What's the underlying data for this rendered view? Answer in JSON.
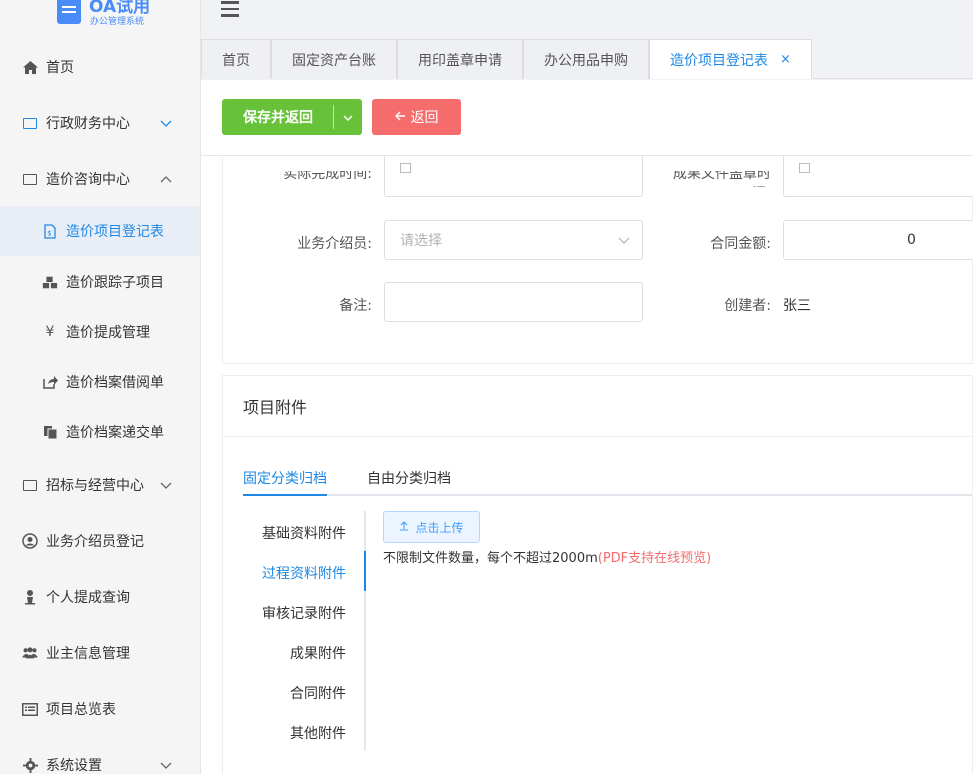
{
  "app": {
    "title": "OA试用",
    "subtitle": "办公管理系统"
  },
  "sidebar": {
    "items": [
      {
        "label": "首页",
        "icon": "home-icon"
      },
      {
        "label": "行政财务中心",
        "icon": "folder-icon"
      },
      {
        "label": "造价咨询中心",
        "icon": "folder-icon"
      },
      {
        "label": "造价项目登记表",
        "icon": "file-icon"
      },
      {
        "label": "造价跟踪子项目",
        "icon": "cubes-icon"
      },
      {
        "label": "造价提成管理",
        "icon": "yen-icon"
      },
      {
        "label": "造价档案借阅单",
        "icon": "share-icon"
      },
      {
        "label": "造价档案递交单",
        "icon": "copy-icon"
      },
      {
        "label": "招标与经营中心",
        "icon": "folder-icon"
      },
      {
        "label": "业务介绍员登记",
        "icon": "user-circle-icon"
      },
      {
        "label": "个人提成查询",
        "icon": "user-icon"
      },
      {
        "label": "业主信息管理",
        "icon": "users-icon"
      },
      {
        "label": "项目总览表",
        "icon": "list-icon"
      },
      {
        "label": "系统设置",
        "icon": "gear-icon"
      }
    ]
  },
  "tabs": [
    {
      "label": "首页"
    },
    {
      "label": "固定资产台账"
    },
    {
      "label": "用印盖章申请"
    },
    {
      "label": "办公用品申购"
    },
    {
      "label": "造价项目登记表",
      "close": "×"
    }
  ],
  "toolbar": {
    "save_label": "保存并返回",
    "back_label": "返回"
  },
  "form": {
    "actual_finish_label": "实际完成时间:",
    "seal_time_label": "成果文件盖章时间:",
    "introducer_label": "业务介绍员:",
    "introducer_placeholder": "请选择",
    "contract_amount_label": "合同金额:",
    "contract_amount_value": "0",
    "remark_label": "备注:",
    "creator_label": "创建者:",
    "creator_value": "张三"
  },
  "attachments": {
    "title": "项目附件",
    "subtabs": [
      "固定分类归档",
      "自由分类归档"
    ],
    "categories": [
      "基础资料附件",
      "过程资料附件",
      "审核记录附件",
      "成果附件",
      "合同附件",
      "其他附件"
    ],
    "upload_label": "点击上传",
    "tip_main": "不限制文件数量，每个不超过2000m",
    "tip_highlight": "(PDF支持在线预览)"
  },
  "colors": {
    "primary": "#1e88e5",
    "save": "#67c23a",
    "back": "#f56c6c"
  }
}
